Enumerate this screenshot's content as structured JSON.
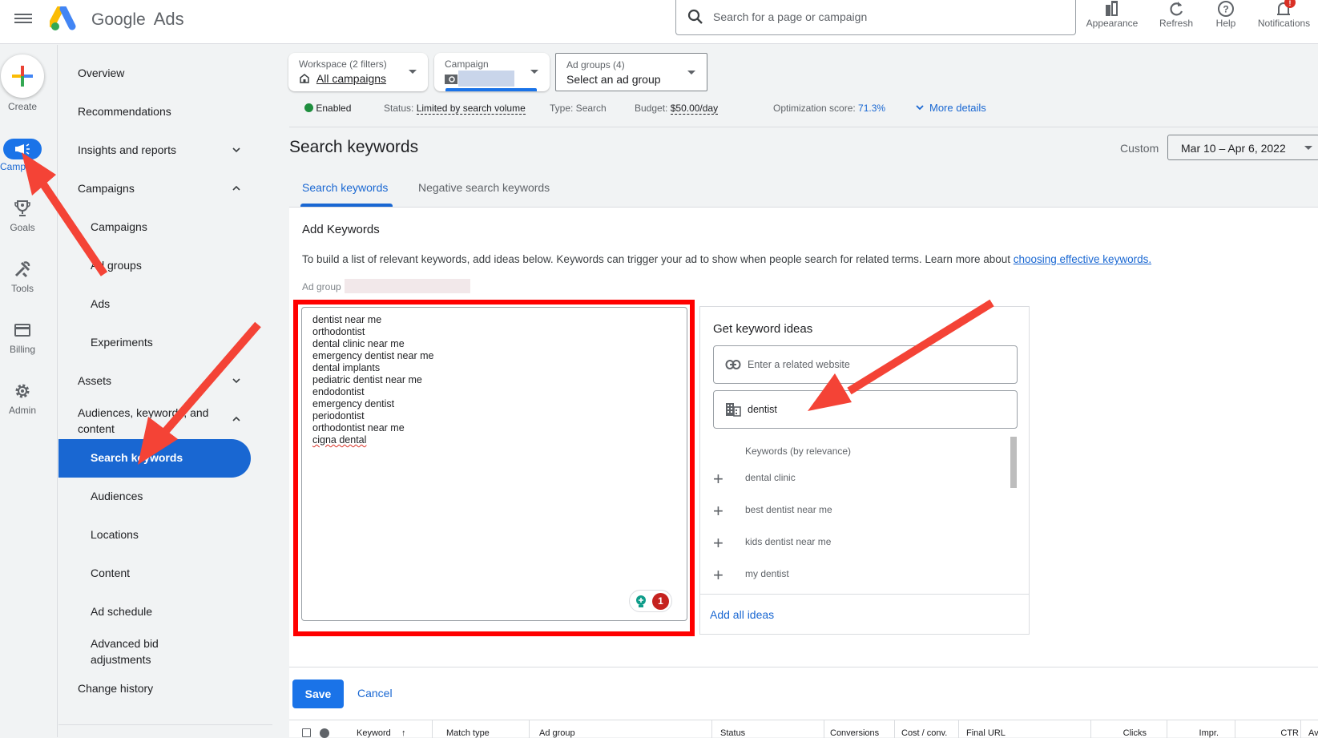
{
  "app": {
    "brand_primary": "Google",
    "brand_secondary": "Ads"
  },
  "search": {
    "placeholder": "Search for a page or campaign"
  },
  "toolbar": {
    "appearance": "Appearance",
    "refresh": "Refresh",
    "help": "Help",
    "notifications": "Notifications",
    "notification_badge": "!"
  },
  "rail": {
    "create": "Create",
    "campaigns": "Campaigns",
    "campaigns_visible": "Camp",
    "goals": "Goals",
    "tools": "Tools",
    "billing": "Billing",
    "admin": "Admin"
  },
  "nav": {
    "overview": "Overview",
    "recommendations": "Recommendations",
    "insights": "Insights and reports",
    "campaigns_group": "Campaigns",
    "campaigns": "Campaigns",
    "ad_groups": "Ad groups",
    "ads": "Ads",
    "experiments": "Experiments",
    "assets": "Assets",
    "audiences_group_line1": "Audiences, keywords, and",
    "audiences_group_line2": "content",
    "search_keywords": "Search keywords",
    "audiences": "Audiences",
    "locations": "Locations",
    "content": "Content",
    "ad_schedule": "Ad schedule",
    "advanced_bid_line1": "Advanced bid",
    "advanced_bid_line2": "adjustments",
    "change_history": "Change history"
  },
  "filters": {
    "workspace_title": "Workspace (2 filters)",
    "workspace_value": "All campaigns",
    "campaign_title": "Campaign",
    "adgroups_title": "Ad groups (4)",
    "adgroups_value": "Select an ad group"
  },
  "status": {
    "enabled": "Enabled",
    "status_label": "Status:",
    "status_value": "Limited by search volume",
    "type_label": "Type: Search",
    "budget_label": "Budget:",
    "budget_value": "$50.00/day",
    "opt_label": "Optimization score:",
    "opt_value": "71.3%",
    "more_details": "More details"
  },
  "page": {
    "title": "Search keywords",
    "date_label": "Custom",
    "date_range": "Mar 10 – Apr 6, 2022",
    "tabs": [
      "Search keywords",
      "Negative search keywords"
    ]
  },
  "add_keywords": {
    "heading": "Add Keywords",
    "description": "To build a list of relevant keywords, add ideas below. Keywords can trigger your ad to show when people search for related terms. Learn more about ",
    "link": "choosing effective keywords.",
    "ad_group_label": "Ad group",
    "keywords": [
      "dentist near me",
      "orthodontist",
      "dental clinic near me",
      "emergency dentist near me",
      "dental implants",
      "pediatric dentist near me",
      "endodontist",
      "emergency dentist",
      "periodontist",
      "orthodontist near me",
      "cigna dental"
    ],
    "grammar_badge_count": "1"
  },
  "ideas": {
    "heading": "Get keyword ideas",
    "website_placeholder": "Enter a related website",
    "product_value": "dentist",
    "list_header": "Keywords (by relevance)",
    "items": [
      "dental clinic",
      "best dentist near me",
      "kids dentist near me",
      "my dentist"
    ],
    "add_all": "Add all ideas"
  },
  "actions": {
    "save": "Save",
    "cancel": "Cancel"
  },
  "table": {
    "columns": [
      "Keyword",
      "Match type",
      "Ad group",
      "Status",
      "Conversions",
      "Cost / conv.",
      "Final URL",
      "Clicks",
      "Impr.",
      "CTR",
      "Av"
    ]
  },
  "colors": {
    "accent": "#1a73e8",
    "highlight": "#ff0000",
    "annotation_arrow": "#f44336",
    "enabled": "#1e8e3e"
  }
}
